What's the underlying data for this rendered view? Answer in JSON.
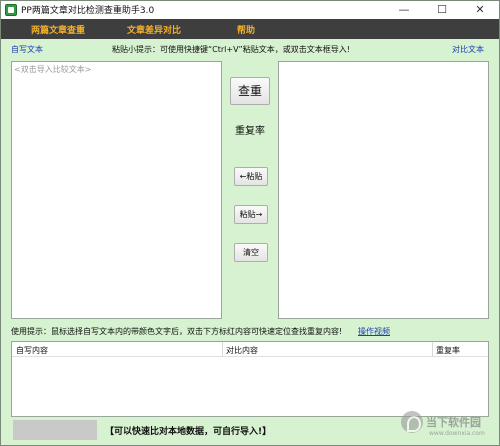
{
  "window": {
    "title": "PP两篇文章对比检测查重助手3.0",
    "controls": {
      "minimize": "—",
      "maximize": "☐",
      "close": "✕"
    }
  },
  "menu": [
    "两篇文章查重",
    "文章差异对比",
    "帮助"
  ],
  "labels": {
    "left": "自写文本",
    "hint": "粘贴小提示：可使用快捷键“Ctrl+V”粘贴文本，或双击文本框导入!",
    "right": "对比文本"
  },
  "left_pane": {
    "placeholder": "<双击导入比较文本>"
  },
  "buttons": {
    "check": "查重",
    "rate_label": "重复率",
    "paste_left": "←粘贴",
    "paste_right": "粘贴→",
    "clear": "清空"
  },
  "usage_tip": "使用提示：鼠标选择自写文本内的带颜色文字后，双击下方标红内容可快速定位查找重复内容!",
  "video_link": "操作视频",
  "results": {
    "columns": [
      "自写内容",
      "对比内容",
      "重复率"
    ]
  },
  "bottom_note": "【可以快速比对本地数据，可自行导入!】",
  "watermark": {
    "title": "当下软件园",
    "url": "www.downxia.com"
  },
  "colors": {
    "menubar": "#3e3e3e",
    "menu_text": "#f2b02a",
    "background": "#d6f2d0",
    "link": "#1a3eb5"
  }
}
